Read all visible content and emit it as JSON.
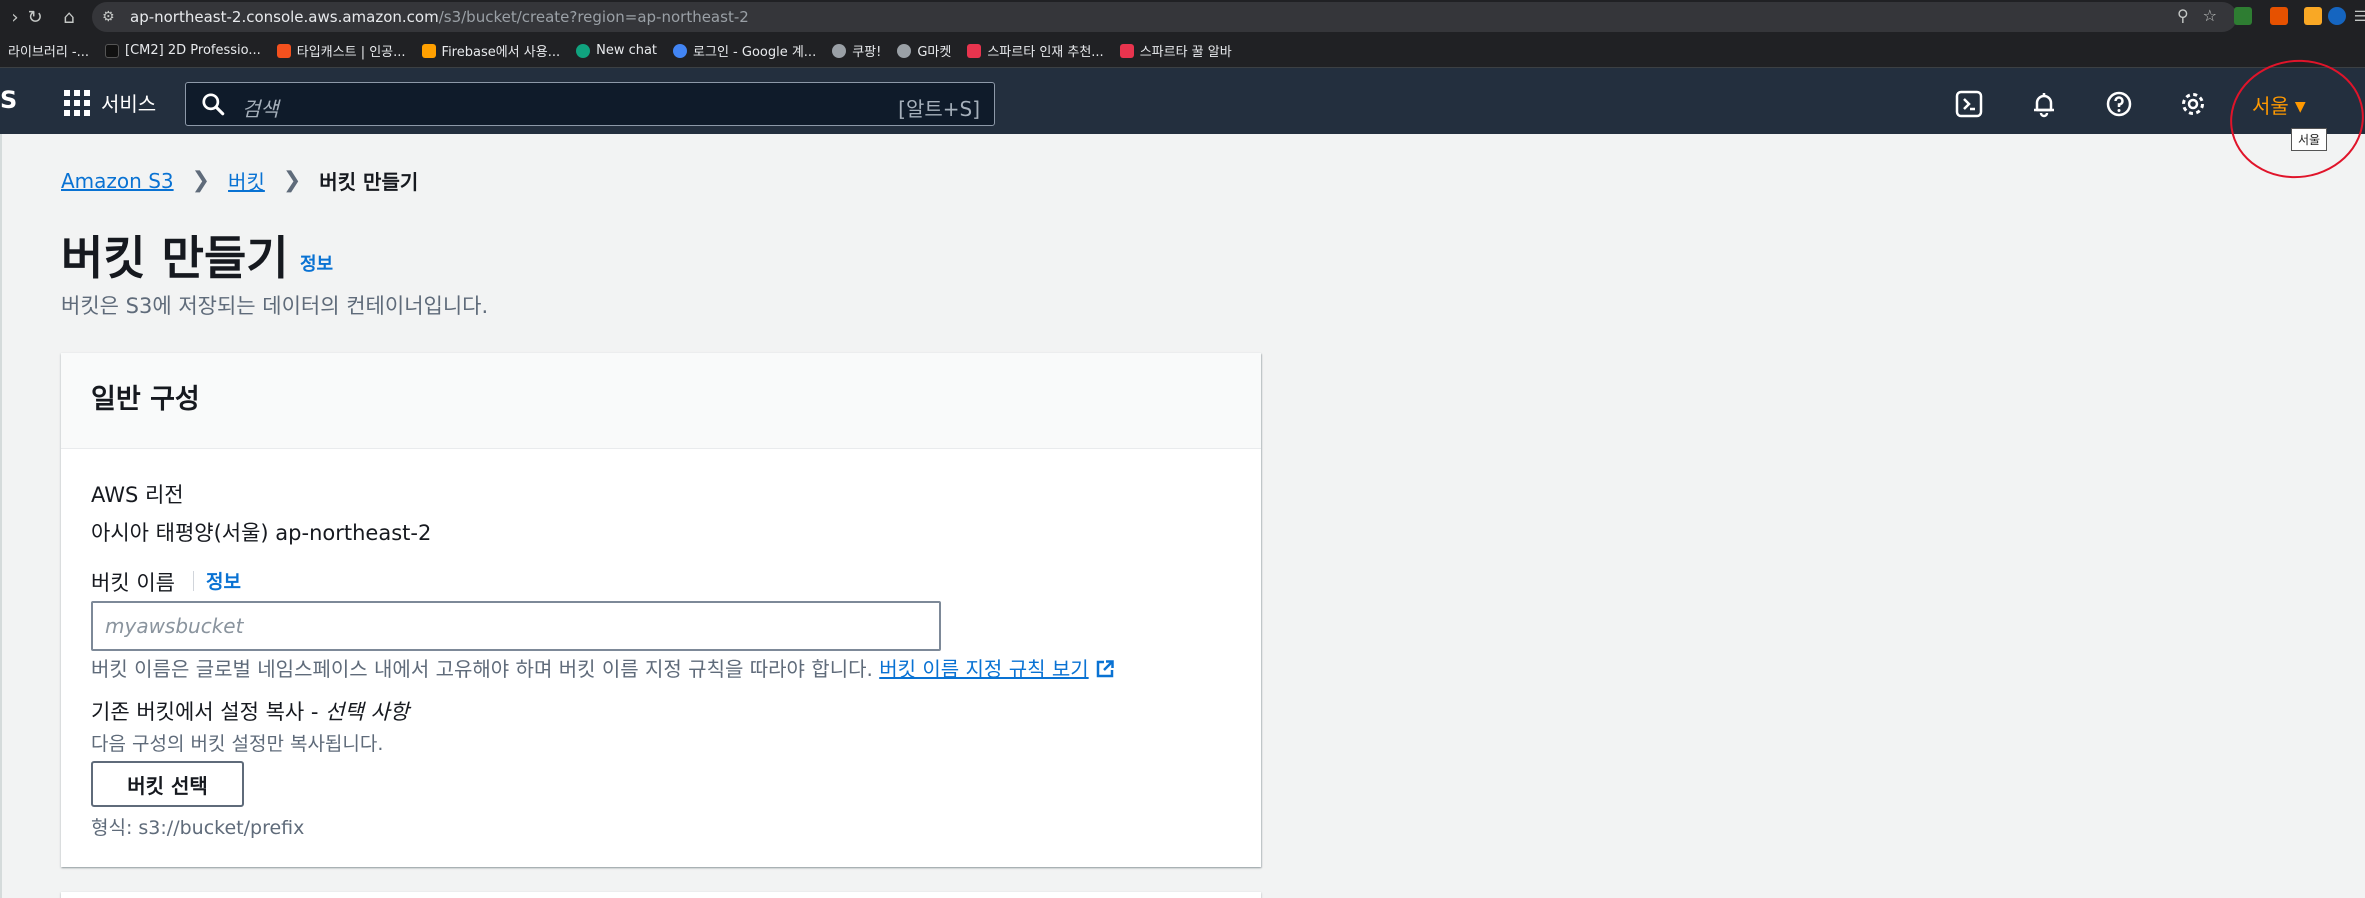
{
  "browser": {
    "url_host": "ap-northeast-2.console.aws.amazon.com",
    "url_path": "/s3/bucket/create?region=ap-northeast-2",
    "bookmarks": [
      {
        "label": "라이브러리 -...",
        "color": "#5f6368"
      },
      {
        "label": "[CM2] 2D Professio...",
        "color": "#111111"
      },
      {
        "label": "타입캐스트 | 인공...",
        "color": "#f4511e"
      },
      {
        "label": "Firebase에서 사용...",
        "color": "#ffa000"
      },
      {
        "label": "New chat",
        "color": "#10a37f"
      },
      {
        "label": "로그인 - Google 계...",
        "color": "#4285f4"
      },
      {
        "label": "쿠팡!",
        "color": "#9aa0a6"
      },
      {
        "label": "G마켓",
        "color": "#9aa0a6"
      },
      {
        "label": "스파르타 인재 추천...",
        "color": "#e8344e"
      },
      {
        "label": "스파르타 꿀 알바",
        "color": "#e8344e"
      }
    ]
  },
  "aws_header": {
    "logo": "S",
    "services_label": "서비스",
    "search_placeholder": "검색",
    "search_shortcut": "[알트+S]",
    "region_label": "서울",
    "region_tooltip": "서울",
    "accent_color": "#ff9900"
  },
  "breadcrumb": {
    "items": [
      "Amazon S3",
      "버킷"
    ],
    "current": "버킷 만들기"
  },
  "page": {
    "title": "버킷 만들기",
    "info_link": "정보",
    "subtitle": "버킷은 S3에 저장되는 데이터의 컨테이너입니다."
  },
  "general_config": {
    "heading": "일반 구성",
    "region_label": "AWS 리전",
    "region_value": "아시아 태평양(서울) ap-northeast-2",
    "bucket_name_label": "버킷 이름",
    "bucket_name_info": "정보",
    "bucket_name_placeholder": "myawsbucket",
    "bucket_name_value": "",
    "hint_text": "버킷 이름은 글로벌 네임스페이스 내에서 고유해야 하며 버킷 이름 지정 규칙을 따라야 합니다.",
    "rules_link": "버킷 이름 지정 규칙 보기",
    "copy_label": "기존 버킷에서 설정 복사 -",
    "copy_optional": "선택 사항",
    "copy_desc": "다음 구성의 버킷 설정만 복사됩니다.",
    "choose_button": "버킷 선택",
    "format_text": "형식: s3://bucket/prefix"
  }
}
